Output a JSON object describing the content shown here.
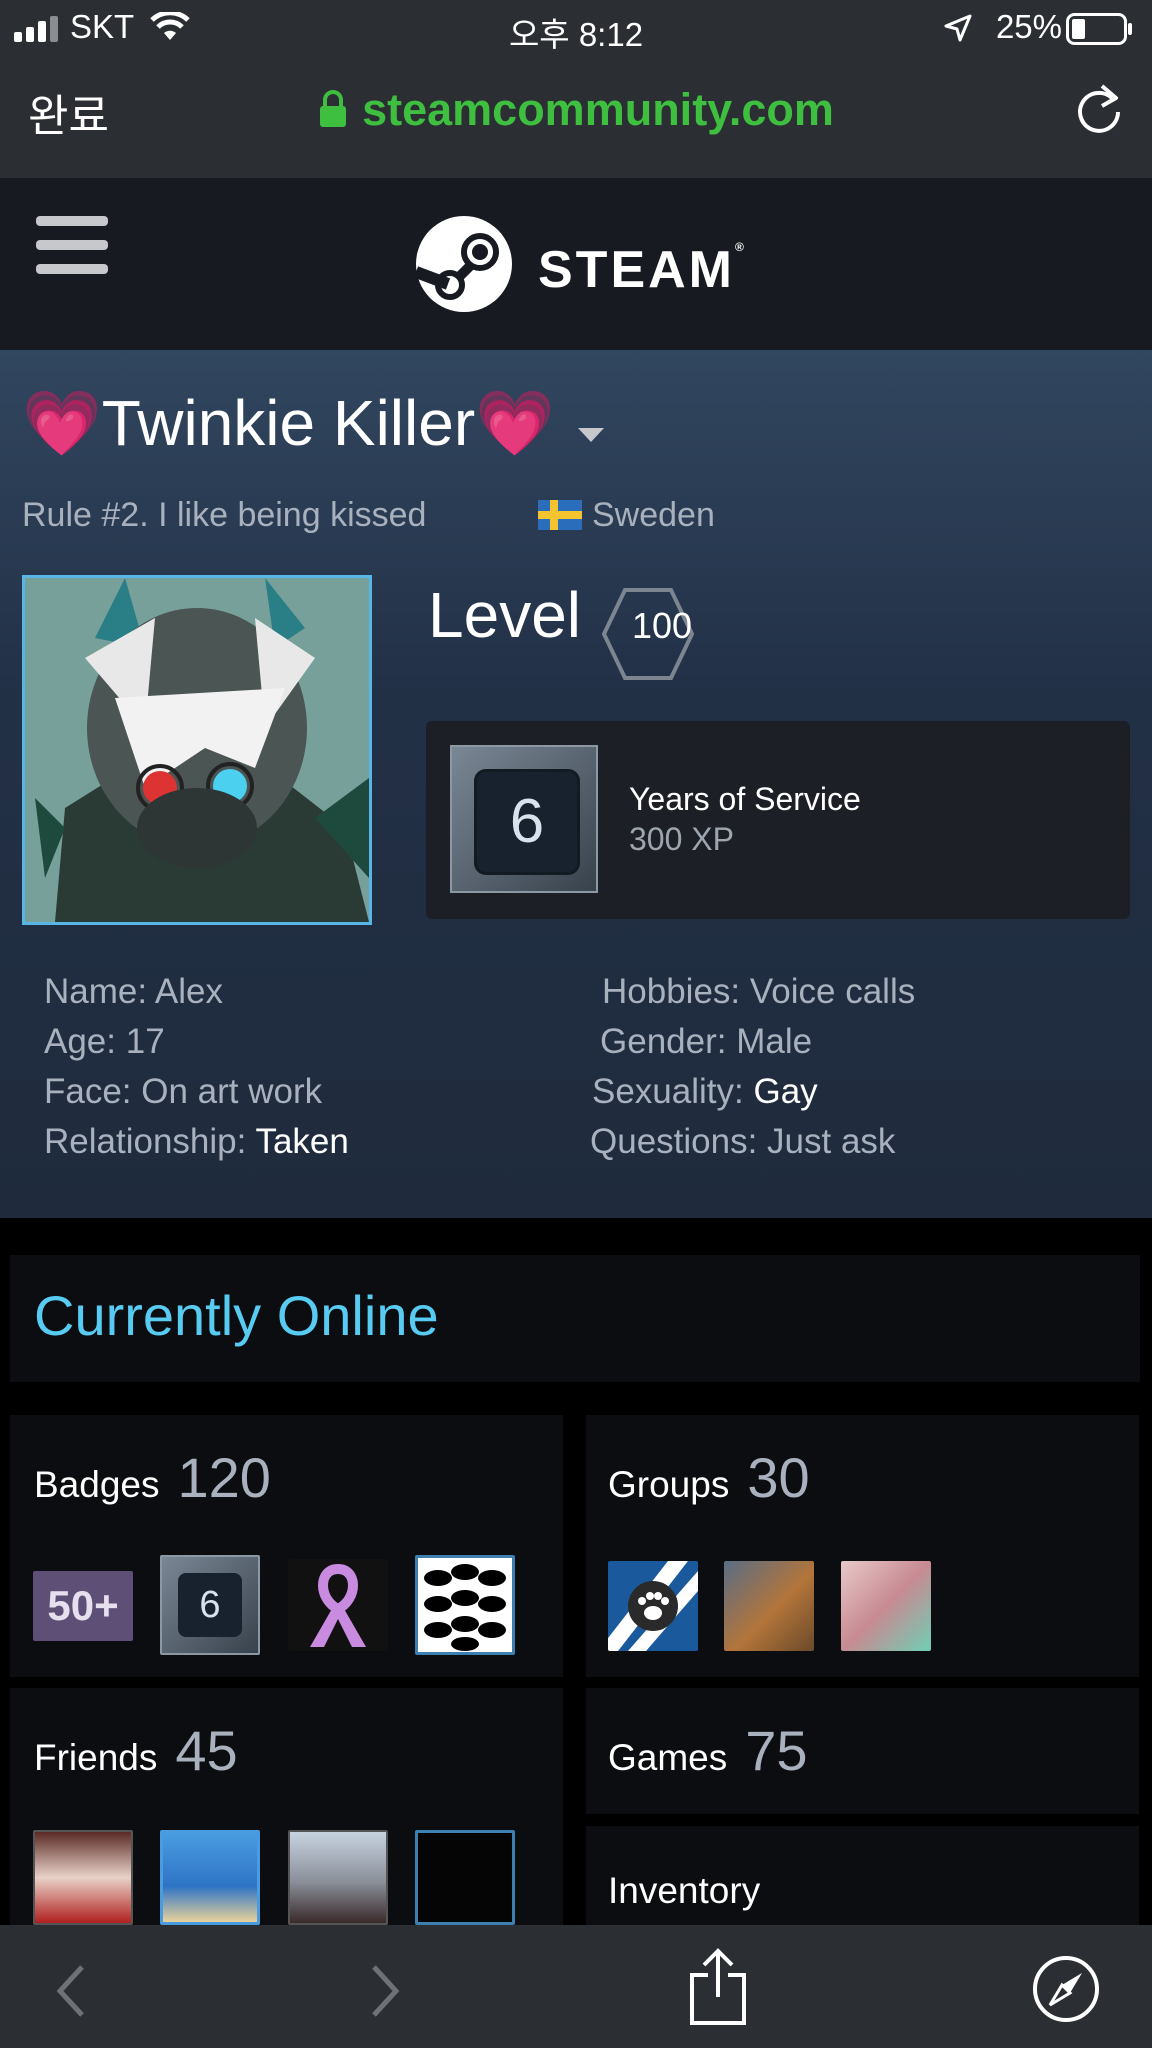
{
  "status_bar": {
    "carrier": "SKT",
    "time": "오후 8:12",
    "battery": "25%"
  },
  "browser": {
    "done_label": "완료",
    "url": "steamcommunity.com"
  },
  "steam_header": {
    "logo_text": "STEAM",
    "reg": "®"
  },
  "profile": {
    "name": "💗Twinkie Killer💗",
    "summary": "Rule #2. I like being kissed",
    "country": "Sweden",
    "level_label": "Level",
    "level": "100",
    "service_badge_number": "6",
    "service_title": "Years of Service",
    "service_xp": "300 XP",
    "info_left": [
      {
        "label": "Name: ",
        "value": "Alex"
      },
      {
        "label": "Age: ",
        "value": "17"
      },
      {
        "label": "Face: ",
        "value": "On art work"
      },
      {
        "label": "Relationship: ",
        "value": "Taken"
      }
    ],
    "info_right": [
      {
        "label": "Hobbies: ",
        "value": "Voice calls"
      },
      {
        "label": "Gender: ",
        "value": "Male"
      },
      {
        "label": "Sexuality: ",
        "value": "Gay"
      },
      {
        "label": "Questions: ",
        "value": "Just ask"
      }
    ]
  },
  "status": "Currently Online",
  "badges": {
    "title": "Badges",
    "count": "120",
    "first_badge_text": "50+",
    "service_badge": "6"
  },
  "groups": {
    "title": "Groups",
    "count": "30"
  },
  "friends": {
    "title": "Friends",
    "count": "45"
  },
  "games": {
    "title": "Games",
    "count": "75"
  },
  "inventory": {
    "title": "Inventory"
  }
}
